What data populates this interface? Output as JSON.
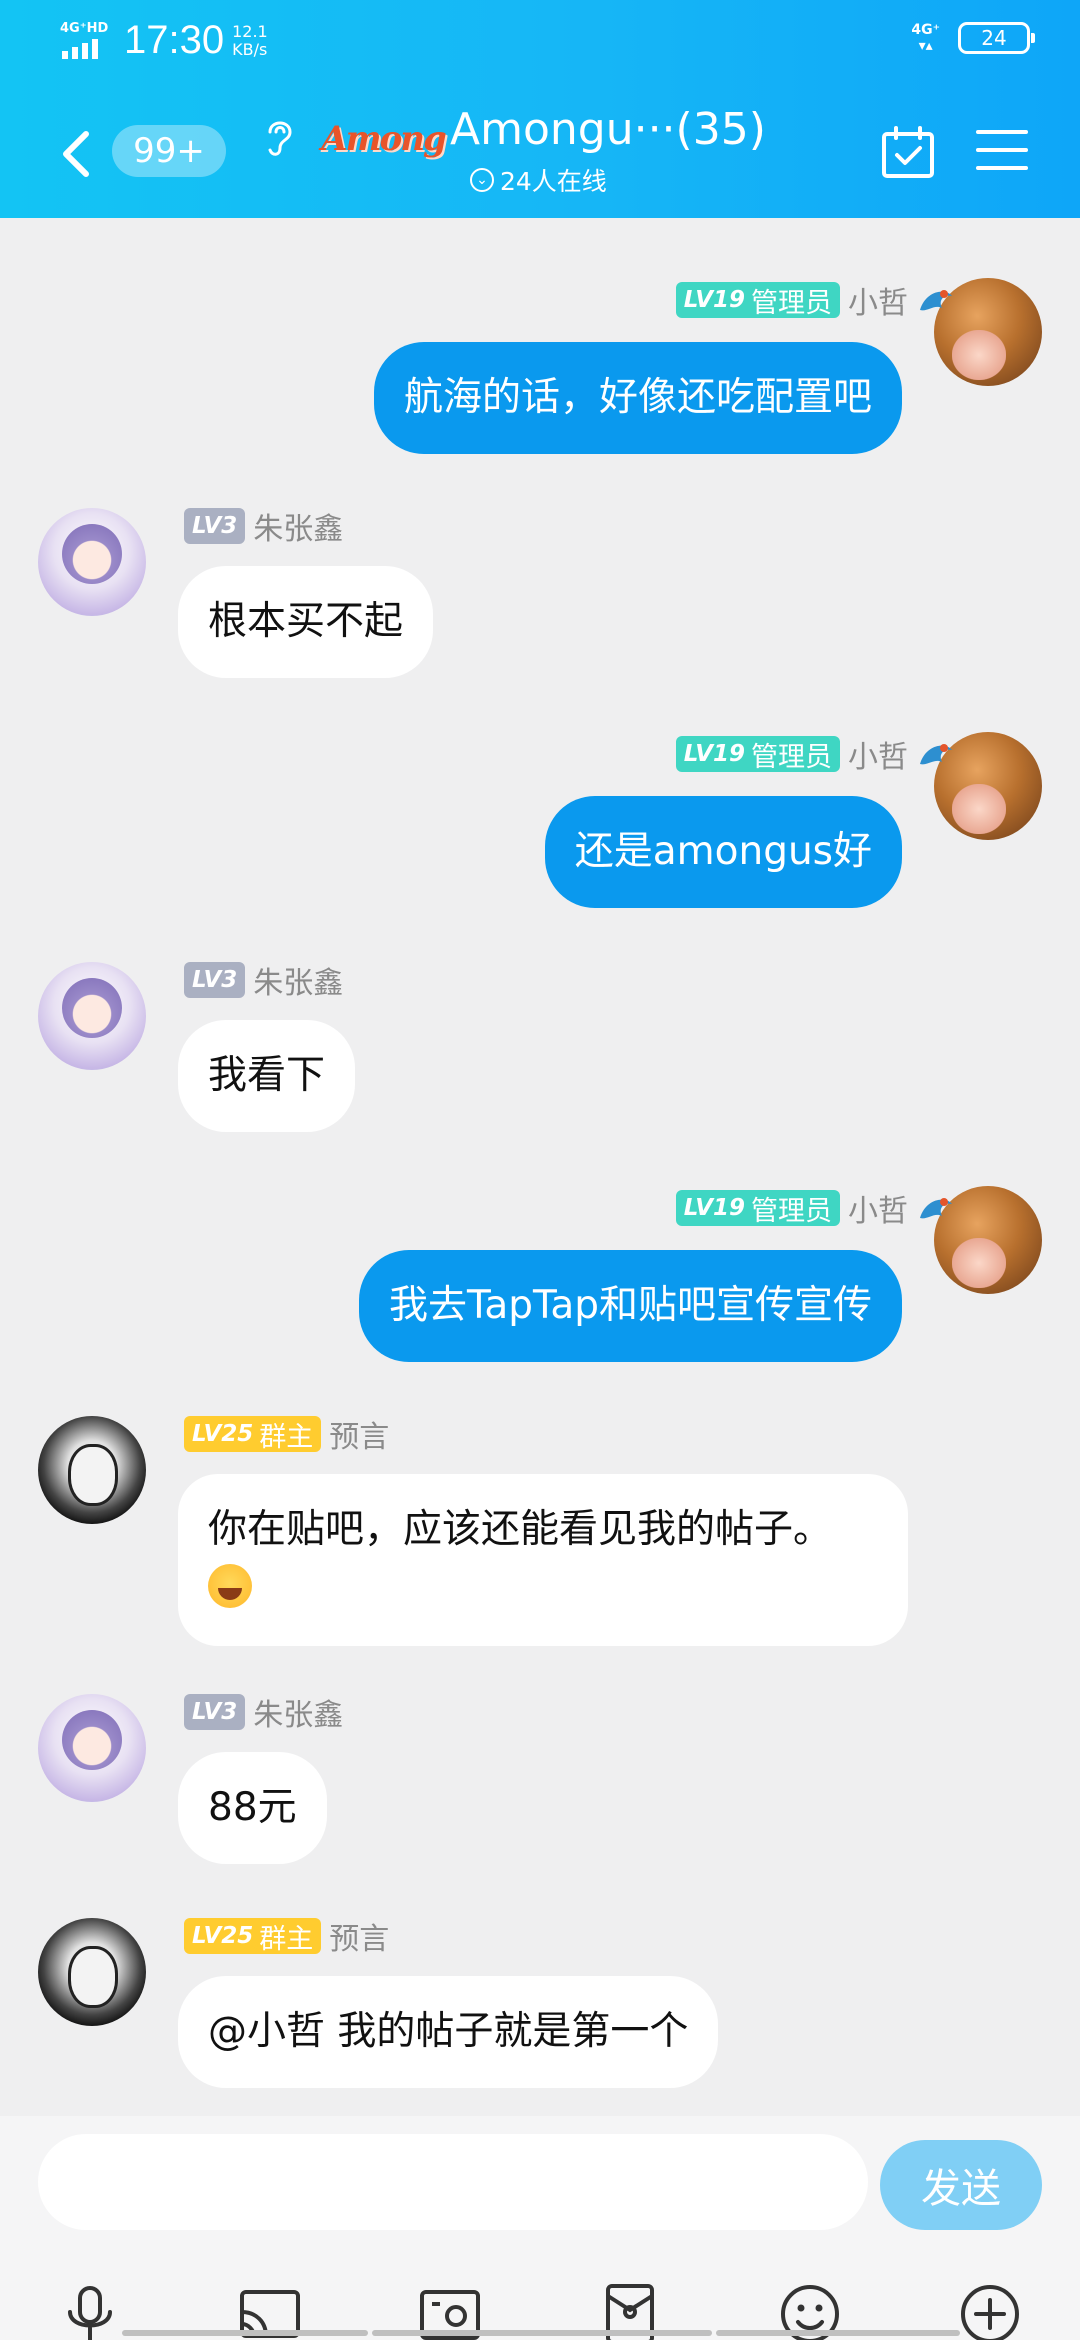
{
  "status_bar": {
    "network_tag": "4G⁺HD",
    "time": "17:30",
    "speed_value": "12.1",
    "speed_unit": "KB/s",
    "right_network": "4G⁺",
    "battery": "24"
  },
  "header": {
    "unread_badge": "99+",
    "group_logo_text": "Among",
    "title": "Amongu···(35)",
    "online_text": "24人在线"
  },
  "messages": [
    {
      "level": "LV19",
      "role": "管理员",
      "name": "小哲",
      "text": "航海的话，好像还吃配置吧"
    },
    {
      "level": "LV3",
      "role": "",
      "name": "朱张鑫",
      "text": "根本买不起"
    },
    {
      "level": "LV19",
      "role": "管理员",
      "name": "小哲",
      "text": "还是amongus好"
    },
    {
      "level": "LV3",
      "role": "",
      "name": "朱张鑫",
      "text": "我看下"
    },
    {
      "level": "LV19",
      "role": "管理员",
      "name": "小哲",
      "text": "我去TapTap和贴吧宣传宣传"
    },
    {
      "level": "LV25",
      "role": "群主",
      "name": "预言",
      "text": "你在贴吧，应该还能看见我的帖子。",
      "emoji": "laugh-emoji"
    },
    {
      "level": "LV3",
      "role": "",
      "name": "朱张鑫",
      "text": "88元"
    },
    {
      "level": "LV25",
      "role": "群主",
      "name": "预言",
      "text": "@小哲 我的帖子就是第一个"
    }
  ],
  "input": {
    "placeholder": "",
    "value": "",
    "send_label": "发送"
  },
  "toolbar_icons": [
    "mic-icon",
    "cast-icon",
    "photo-icon",
    "red-packet-icon",
    "emoji-icon",
    "plus-icon"
  ],
  "colors": {
    "header": "#13c4f4",
    "self_bubble": "#0a99ee",
    "admin_badge": "#3fd6c3",
    "member_badge": "#aab0c2",
    "owner_badge": "#ffcc2f",
    "send_button": "#80cff5"
  }
}
